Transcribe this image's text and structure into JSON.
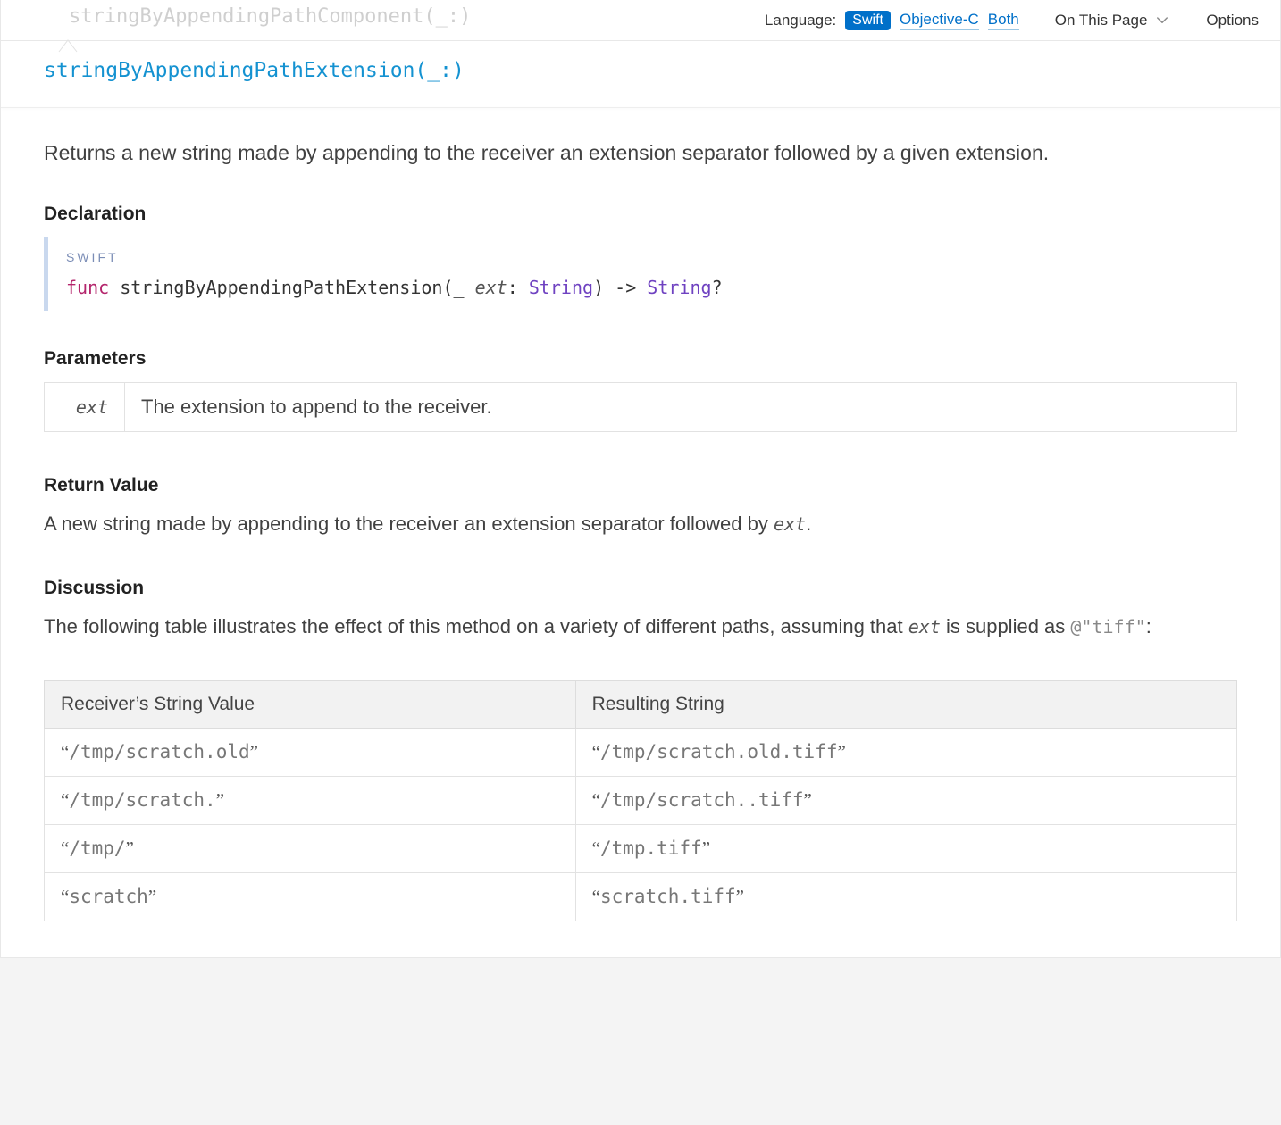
{
  "previous_method": "stringByAppendingPathComponent(_:)",
  "topbar": {
    "language_label": "Language:",
    "swift": "Swift",
    "objc": "Objective-C",
    "both": "Both",
    "on_this_page": "On This Page",
    "options": "Options"
  },
  "title": "stringByAppendingPathExtension(_:)",
  "summary": "Returns a new string made by appending to the receiver an extension separator followed by a given extension.",
  "declaration": {
    "heading": "Declaration",
    "language": "SWIFT",
    "tokens": {
      "keyword": "func",
      "name": "stringByAppendingPathExtension",
      "open": "(",
      "underscore": "_",
      "param": "ext",
      "colon": ":",
      "type": "String",
      "close": ")",
      "arrow": "->",
      "returnType": "String",
      "optional": "?"
    }
  },
  "parameters": {
    "heading": "Parameters",
    "name": "ext",
    "desc": "The extension to append to the receiver."
  },
  "return_value": {
    "heading": "Return Value",
    "text_pre": "A new string made by appending to the receiver an extension separator followed by ",
    "code": "ext",
    "text_post": "."
  },
  "discussion": {
    "heading": "Discussion",
    "text_pre": "The following table illustrates the effect of this method on a variety of different paths, assuming that ",
    "code1": "ext",
    "text_mid": " is supplied as ",
    "code2": "@\"tiff\"",
    "text_post": ":"
  },
  "examples": {
    "headers": [
      "Receiver’s String Value",
      "Resulting String"
    ],
    "rows": [
      {
        "in": "/tmp/scratch.old",
        "out": "/tmp/scratch.old.tiff"
      },
      {
        "in": "/tmp/scratch.",
        "out": "/tmp/scratch..tiff"
      },
      {
        "in": "/tmp/",
        "out": "/tmp.tiff"
      },
      {
        "in": "scratch",
        "out": "scratch.tiff"
      }
    ]
  }
}
